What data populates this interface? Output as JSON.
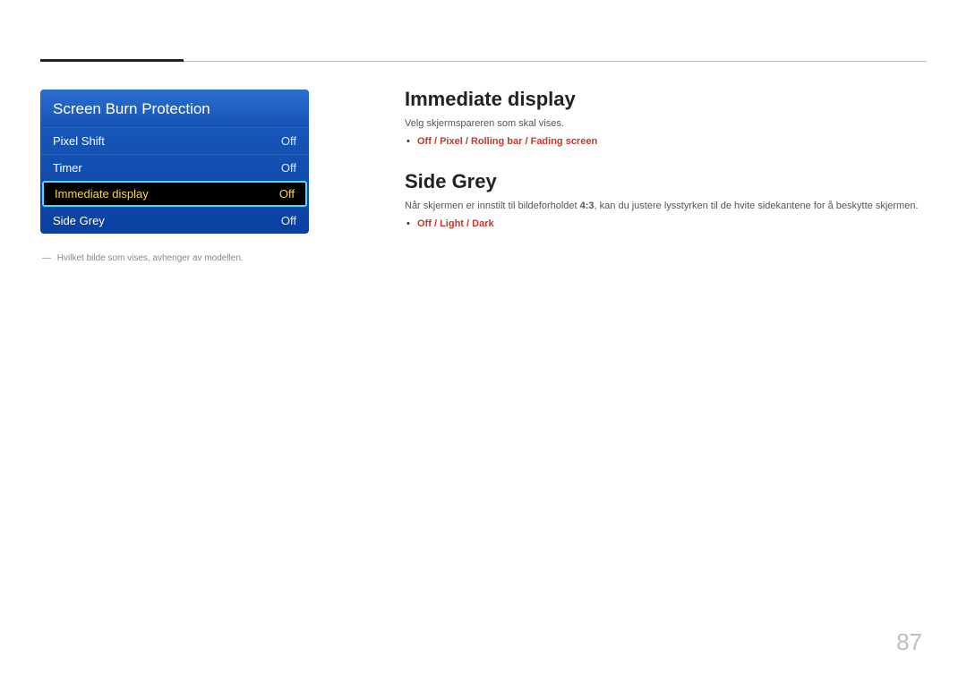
{
  "menu": {
    "title": "Screen Burn Protection",
    "rows": [
      {
        "label": "Pixel Shift",
        "value": "Off",
        "selected": false
      },
      {
        "label": "Timer",
        "value": "Off",
        "selected": false
      },
      {
        "label": "Immediate display",
        "value": "Off",
        "selected": true
      },
      {
        "label": "Side Grey",
        "value": "Off",
        "selected": false
      }
    ]
  },
  "footnote": {
    "dash": "―",
    "text": "Hvilket bilde som vises, avhenger av modellen."
  },
  "sections": {
    "immediate": {
      "heading": "Immediate display",
      "desc": "Velg skjermspareren som skal vises.",
      "options": [
        "Off",
        "Pixel",
        "Rolling bar",
        "Fading screen"
      ]
    },
    "sidegrey": {
      "heading": "Side Grey",
      "desc_pre": "Når skjermen er innstilt til bildeforholdet ",
      "desc_bold": "4:3",
      "desc_post": ", kan du justere lysstyrken til de hvite sidekantene for å beskytte skjermen.",
      "options": [
        "Off",
        "Light",
        "Dark"
      ]
    }
  },
  "page_number": "87"
}
